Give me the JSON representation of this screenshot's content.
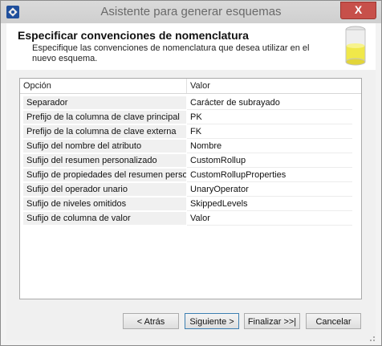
{
  "window": {
    "title": "Asistente para generar esquemas",
    "close_label": "X"
  },
  "header": {
    "title": "Especificar convenciones de nomenclatura",
    "subtitle": "Especifique las convenciones de nomenclatura que desea utilizar en el nuevo esquema."
  },
  "grid": {
    "columns": [
      "Opción",
      "Valor"
    ],
    "rows": [
      {
        "option": "Separador",
        "value": "Carácter de subrayado"
      },
      {
        "option": "Prefijo de la columna de clave principal",
        "value": "PK"
      },
      {
        "option": "Prefijo de la columna de clave externa",
        "value": "FK"
      },
      {
        "option": "Sufijo del nombre del atributo",
        "value": "Nombre"
      },
      {
        "option": "Sufijo del resumen personalizado",
        "value": "CustomRollup"
      },
      {
        "option": "Sufijo de propiedades del resumen person...",
        "value": "CustomRollupProperties"
      },
      {
        "option": "Sufijo del operador unario",
        "value": "UnaryOperator"
      },
      {
        "option": "Sufijo de niveles omitidos",
        "value": "SkippedLevels"
      },
      {
        "option": "Sufijo de columna de valor",
        "value": "Valor"
      }
    ]
  },
  "buttons": {
    "back": "< Atrás",
    "next": "Siguiente >",
    "finish": "Finalizar >>|",
    "cancel": "Cancelar"
  }
}
